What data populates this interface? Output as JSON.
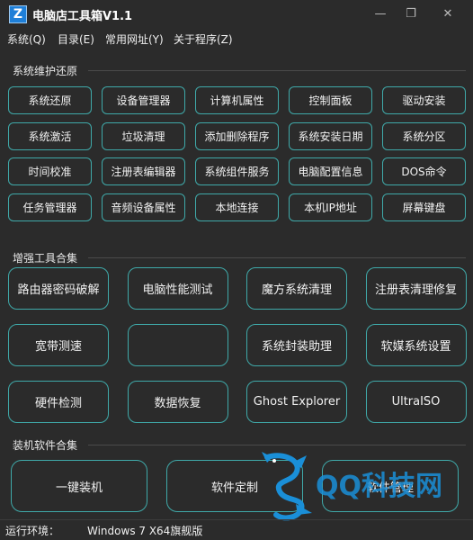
{
  "app": {
    "logo_letter": "Z",
    "title": "电脑店工具箱V1.1"
  },
  "window_controls": {
    "minimize": "—",
    "maximize": "❐",
    "close": "✕"
  },
  "menu": {
    "system": "系统(Q)",
    "directory": "目录(E)",
    "common_sites": "常用网址(Y)",
    "about": "关于程序(Z)"
  },
  "groups": {
    "maintenance": {
      "label": "系统维护还原",
      "buttons": [
        "系统还原",
        "设备管理器",
        "计算机属性",
        "控制面板",
        "驱动安装",
        "系统激活",
        "垃圾清理",
        "添加删除程序",
        "系统安装日期",
        "系统分区",
        "时间校准",
        "注册表编辑器",
        "系统组件服务",
        "电脑配置信息",
        "DOS命令",
        "任务管理器",
        "音频设备属性",
        "本地连接",
        "本机IP地址",
        "屏幕键盘"
      ]
    },
    "enhance": {
      "label": "增强工具合集",
      "buttons": [
        "路由器密码破解",
        "电脑性能测试",
        "魔方系统清理",
        "注册表清理修复",
        "宽带测速",
        "",
        "系统封装助理",
        "软媒系统设置",
        "硬件检测",
        "数据恢复",
        "Ghost Explorer",
        "UltraISO"
      ]
    },
    "install": {
      "label": "装机软件合集",
      "buttons": [
        "一键装机",
        "软件定制",
        "软件管理"
      ]
    }
  },
  "status": {
    "label": "运行环境：",
    "value": "Windows 7  X64旗舰版"
  },
  "watermark": {
    "text": "QQ科技网"
  },
  "colors": {
    "background": "#2b2b2b",
    "button_border": "#3fa9a9",
    "logo_blue": "#1e7fd8",
    "watermark_blue": "#1a8fd8"
  }
}
